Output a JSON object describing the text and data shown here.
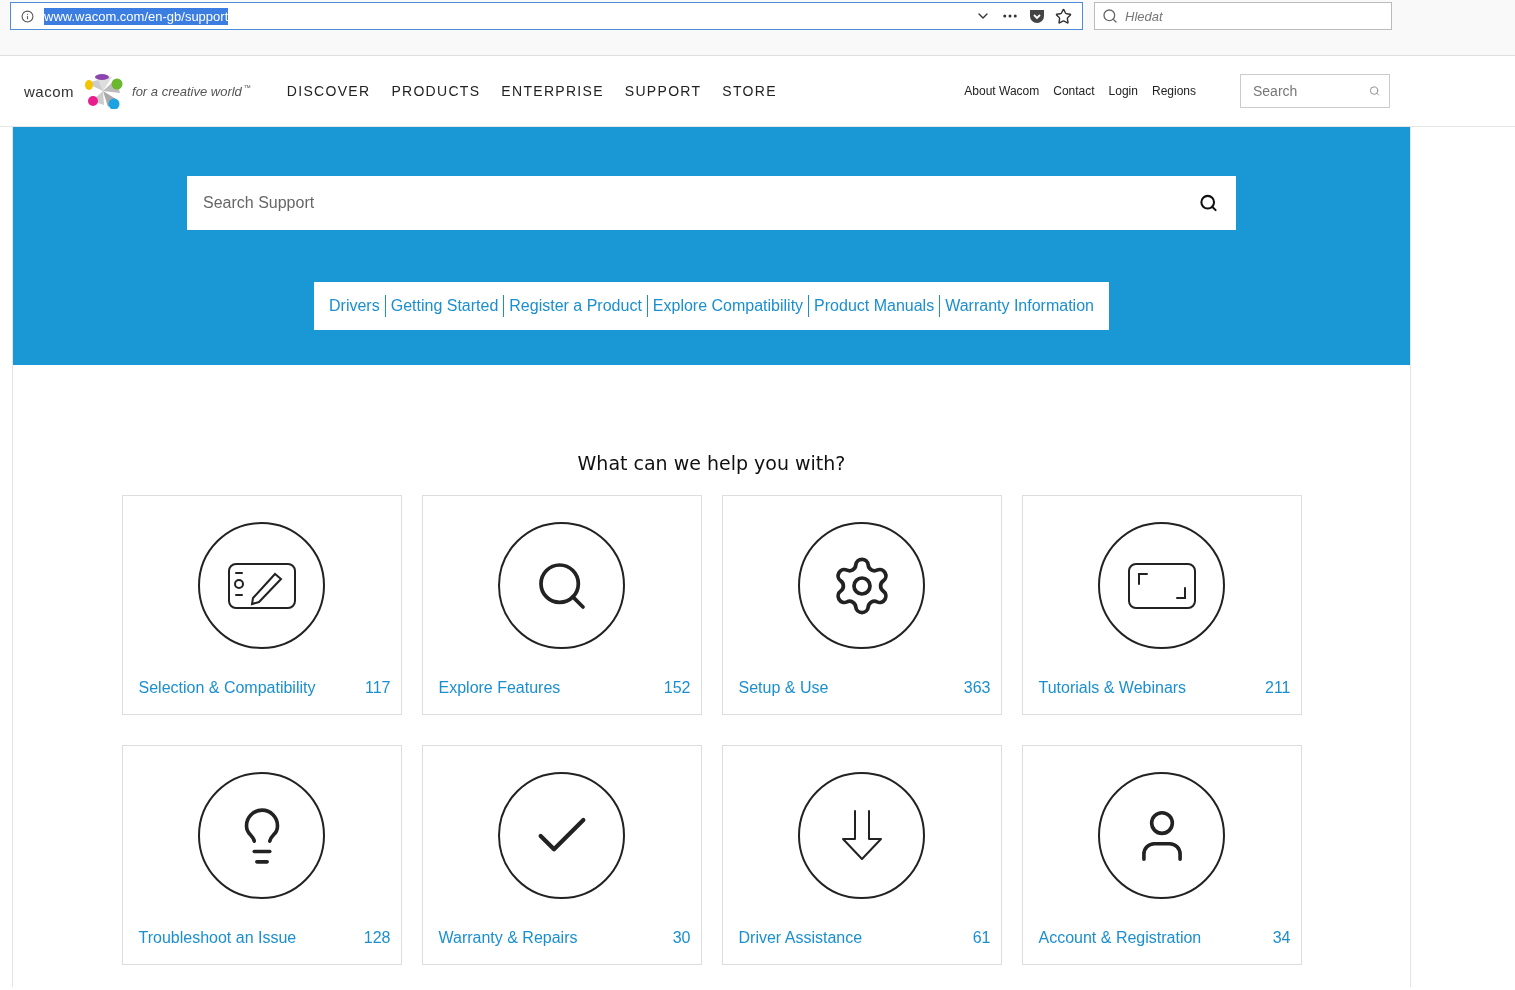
{
  "browser": {
    "url": "www.wacom.com/en-gb/support",
    "url_selected": true,
    "search_placeholder": "Hledat"
  },
  "header": {
    "logo_text": "wacom",
    "tagline": "for a creative world",
    "trademark": "™",
    "nav": [
      "DISCOVER",
      "PRODUCTS",
      "ENTERPRISE",
      "SUPPORT",
      "STORE"
    ],
    "utility_links": [
      "About Wacom",
      "Contact",
      "Login",
      "Regions"
    ],
    "search_placeholder": "Search"
  },
  "hero": {
    "search_placeholder": "Search Support",
    "quick_links": [
      "Drivers",
      "Getting Started",
      "Register a Product",
      "Explore Compatibility",
      "Product Manuals",
      "Warranty Information"
    ]
  },
  "help": {
    "heading": "What can we help you with?",
    "cards": [
      {
        "kind": "tablet",
        "label": "Selection & Compatibility",
        "count": "117"
      },
      {
        "kind": "search",
        "label": "Explore Features",
        "count": "152"
      },
      {
        "kind": "gear",
        "label": "Setup & Use",
        "count": "363"
      },
      {
        "kind": "screen",
        "label": "Tutorials & Webinars",
        "count": "211"
      },
      {
        "kind": "bulb",
        "label": "Troubleshoot an Issue",
        "count": "128"
      },
      {
        "kind": "check",
        "label": "Warranty & Repairs",
        "count": "30"
      },
      {
        "kind": "download",
        "label": "Driver Assistance",
        "count": "61"
      },
      {
        "kind": "person",
        "label": "Account & Registration",
        "count": "34"
      }
    ]
  }
}
